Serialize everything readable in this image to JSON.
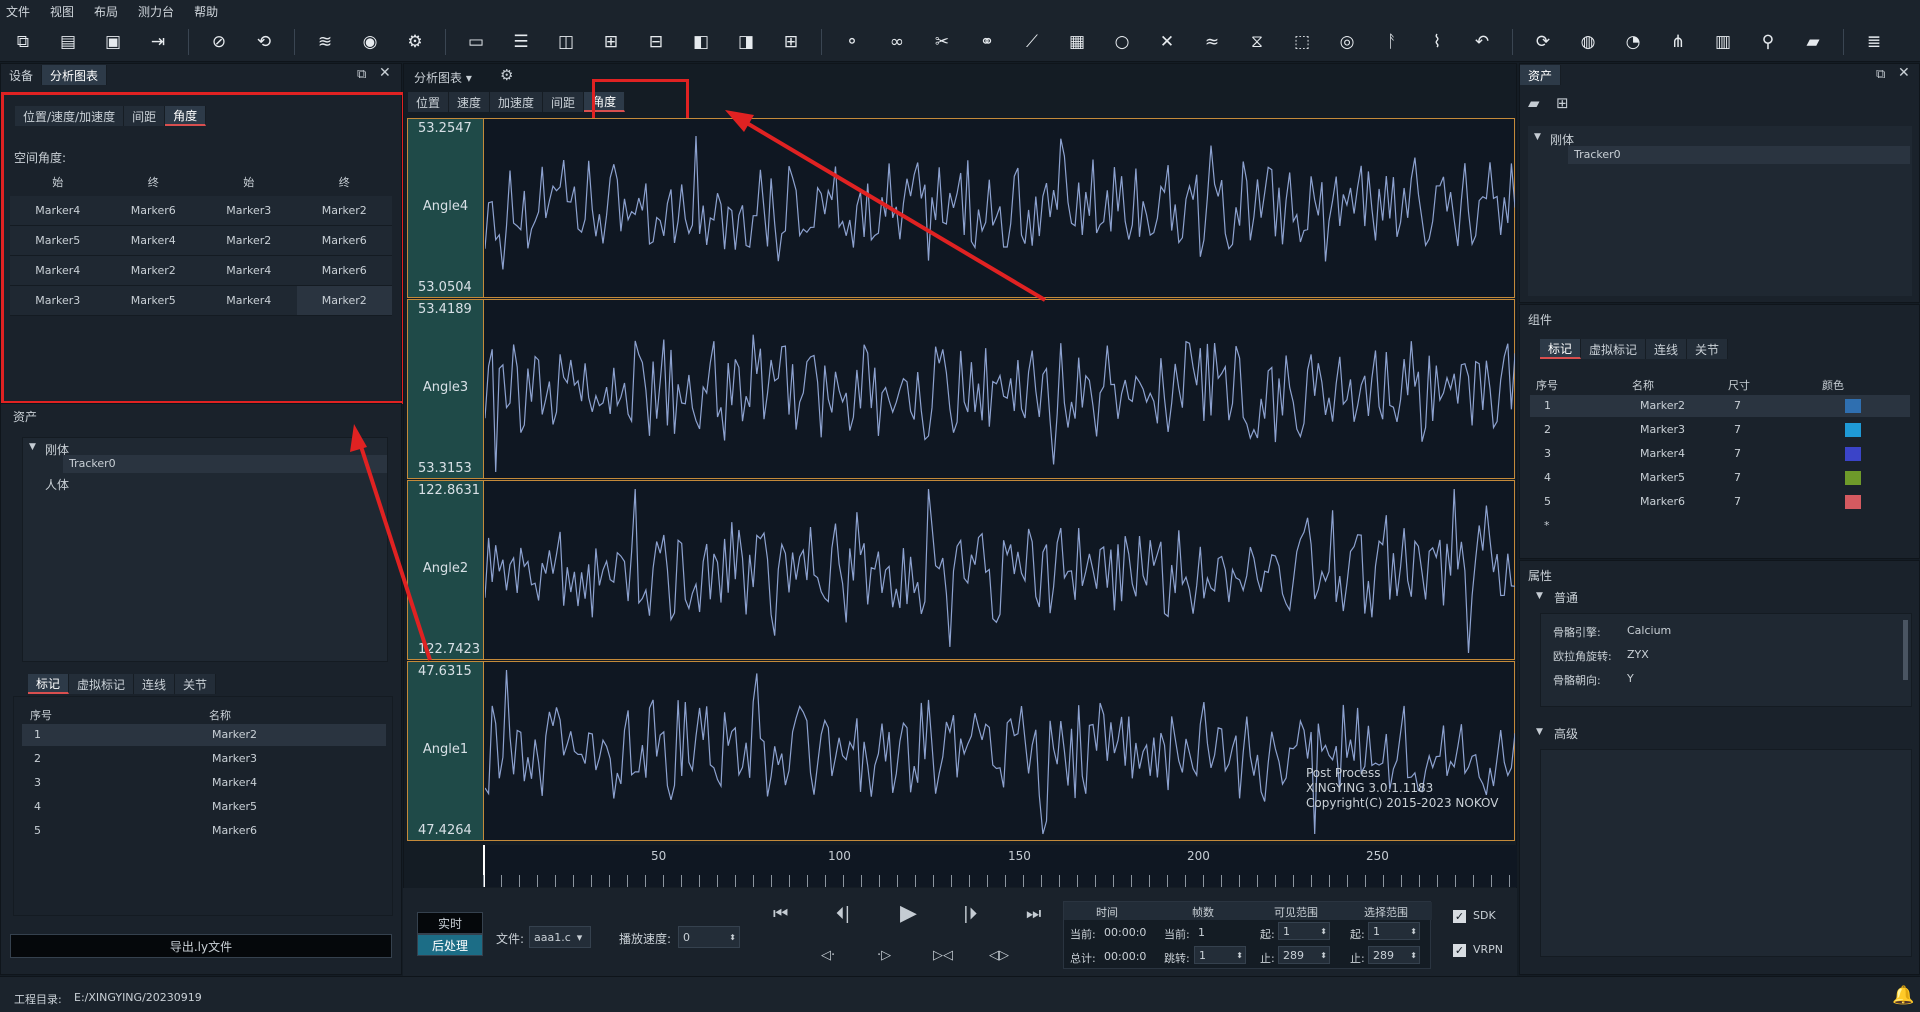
{
  "menu": [
    "文件",
    "视图",
    "布局",
    "测力台",
    "帮助"
  ],
  "toolbar_icons": [
    "open-icon",
    "new-file-icon",
    "save-icon",
    "export-icon",
    "hide-icon",
    "refresh-icon",
    "layers-icon",
    "wifi-icon",
    "settings-gear-icon",
    "monitor-icon",
    "layout-top-icon",
    "layout-split-icon",
    "layout-quad-icon",
    "layout-bottom-icon",
    "layout-left-icon",
    "layout-right-icon",
    "layout-grid-icon",
    "link-marker-icon",
    "connect-icon",
    "cut-icon",
    "unlink-icon",
    "bone-icon",
    "calculator-icon",
    "circle-icon",
    "delete-cross-icon",
    "wave-icon",
    "filter-icon",
    "select-box-icon",
    "target-icon",
    "run-icon",
    "chart-line-icon",
    "undo-icon",
    "camera-refresh-icon",
    "3d-icon",
    "gauge-icon",
    "graph-icon",
    "bar-chart-icon",
    "pin-icon",
    "folder-icon",
    "list-icon"
  ],
  "left_top": {
    "tabs": [
      "设备",
      "分析图表"
    ],
    "subtabs": [
      "位置/速度/加速度",
      "间距",
      "角度"
    ],
    "section_label": "空间角度:",
    "headers": [
      "始",
      "终",
      "始",
      "终"
    ],
    "rows": [
      [
        "Marker4",
        "Marker6",
        "Marker3",
        "Marker2"
      ],
      [
        "Marker5",
        "Marker4",
        "Marker2",
        "Marker6"
      ],
      [
        "Marker4",
        "Marker2",
        "Marker4",
        "Marker6"
      ],
      [
        "Marker3",
        "Marker5",
        "Marker4",
        "Marker2"
      ]
    ]
  },
  "left_assets": {
    "title": "资产",
    "tree_root": "刚体",
    "tree_child": "Tracker0",
    "tree_other": "人体",
    "tabs": [
      "标记",
      "虚拟标记",
      "连线",
      "关节"
    ],
    "headers": [
      "序号",
      "名称"
    ],
    "rows": [
      [
        "1",
        "Marker2"
      ],
      [
        "2",
        "Marker3"
      ],
      [
        "3",
        "Marker4"
      ],
      [
        "4",
        "Marker5"
      ],
      [
        "5",
        "Marker6"
      ]
    ],
    "export_label": "导出.ly文件"
  },
  "center": {
    "title": "分析图表",
    "tabs": [
      "位置",
      "速度",
      "加速度",
      "间距",
      "角度"
    ],
    "charts": [
      {
        "name": "Angle4",
        "max": "53.2547",
        "min": "53.0504"
      },
      {
        "name": "Angle3",
        "max": "53.4189",
        "min": "53.3153"
      },
      {
        "name": "Angle2",
        "max": "122.8631",
        "min": "122.7423"
      },
      {
        "name": "Angle1",
        "max": "47.6315",
        "min": "47.4264"
      }
    ],
    "watermark": [
      "Post Process",
      "XINGYING 3.0.1.1183",
      "Copyright(C) 2015-2023 NOKOV"
    ],
    "ruler_ticks": [
      "50",
      "100",
      "150",
      "200",
      "250"
    ]
  },
  "playback": {
    "mode_realtime": "实时",
    "mode_post": "后处理",
    "file_label": "文件:",
    "file_value": "aaa1.c",
    "speed_label": "播放速度:",
    "speed_value": "0",
    "time_header": "时间",
    "frame_header": "帧数",
    "visible_header": "可见范围",
    "select_header": "选择范围",
    "current_label": "当前:",
    "total_label": "总计:",
    "jump_label": "跳转:",
    "start_label": "起:",
    "end_label": "止:",
    "time_current": "00:00:0(",
    "time_total": "00:00:0",
    "frame_current": "1",
    "frame_jump": "1",
    "visible_start": "1",
    "visible_end": "289",
    "select_start": "1",
    "select_end": "289",
    "sdk": "SDK",
    "vrpn": "VRPN"
  },
  "right": {
    "assets_title": "资产",
    "tree_root": "刚体",
    "tree_child": "Tracker0",
    "components_title": "组件",
    "tabs": [
      "标记",
      "虚拟标记",
      "连线",
      "关节"
    ],
    "headers": [
      "序号",
      "名称",
      "尺寸",
      "颜色"
    ],
    "rows": [
      {
        "id": "1",
        "name": "Marker2",
        "size": "7",
        "color": "#2f6fb0"
      },
      {
        "id": "2",
        "name": "Marker3",
        "size": "7",
        "color": "#1f9ad6"
      },
      {
        "id": "3",
        "name": "Marker4",
        "size": "7",
        "color": "#3b44c8"
      },
      {
        "id": "4",
        "name": "Marker5",
        "size": "7",
        "color": "#6e9a2a"
      },
      {
        "id": "5",
        "name": "Marker6",
        "size": "7",
        "color": "#d45a60"
      }
    ],
    "star": "*",
    "props_title": "属性",
    "general": "普通",
    "advanced": "高级",
    "props": [
      [
        "骨骼引擎:",
        "Calcium"
      ],
      [
        "欧拉角旋转:",
        "ZYX"
      ],
      [
        "骨骼朝向:",
        "Y"
      ]
    ]
  },
  "status": {
    "project_label": "工程目录:",
    "project_path": "E:/XINGYING/20230919"
  }
}
